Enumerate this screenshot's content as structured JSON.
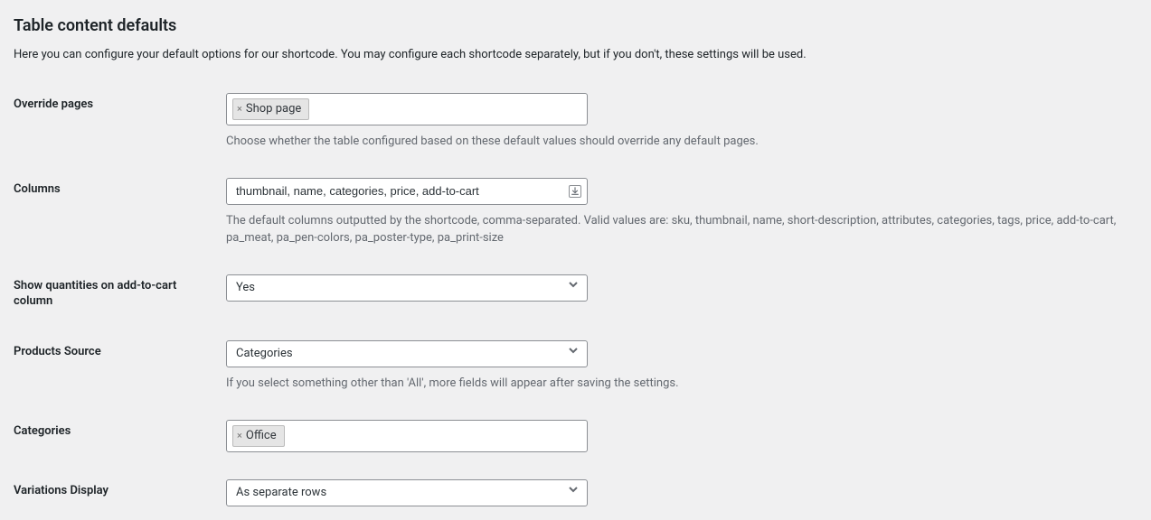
{
  "heading": "Table content defaults",
  "intro": "Here you can configure your default options for our shortcode. You may configure each shortcode separately, but if you don't, these settings will be used.",
  "fields": {
    "override_pages": {
      "label": "Override pages",
      "tag": "Shop page",
      "description": "Choose whether the table configured based on these default values should override any default pages."
    },
    "columns": {
      "label": "Columns",
      "value": "thumbnail, name, categories, price, add-to-cart",
      "description": "The default columns outputted by the shortcode, comma-separated. Valid values are: sku, thumbnail, name, short-description, attributes, categories, tags, price, add-to-cart, pa_meat, pa_pen-colors, pa_poster-type, pa_print-size"
    },
    "show_quantities": {
      "label": "Show quantities on add-to-cart column",
      "value": "Yes"
    },
    "products_source": {
      "label": "Products Source",
      "value": "Categories",
      "description": "If you select something other than 'All', more fields will appear after saving the settings."
    },
    "categories": {
      "label": "Categories",
      "tag": "Office"
    },
    "variations_display": {
      "label": "Variations Display",
      "value": "As separate rows"
    }
  }
}
